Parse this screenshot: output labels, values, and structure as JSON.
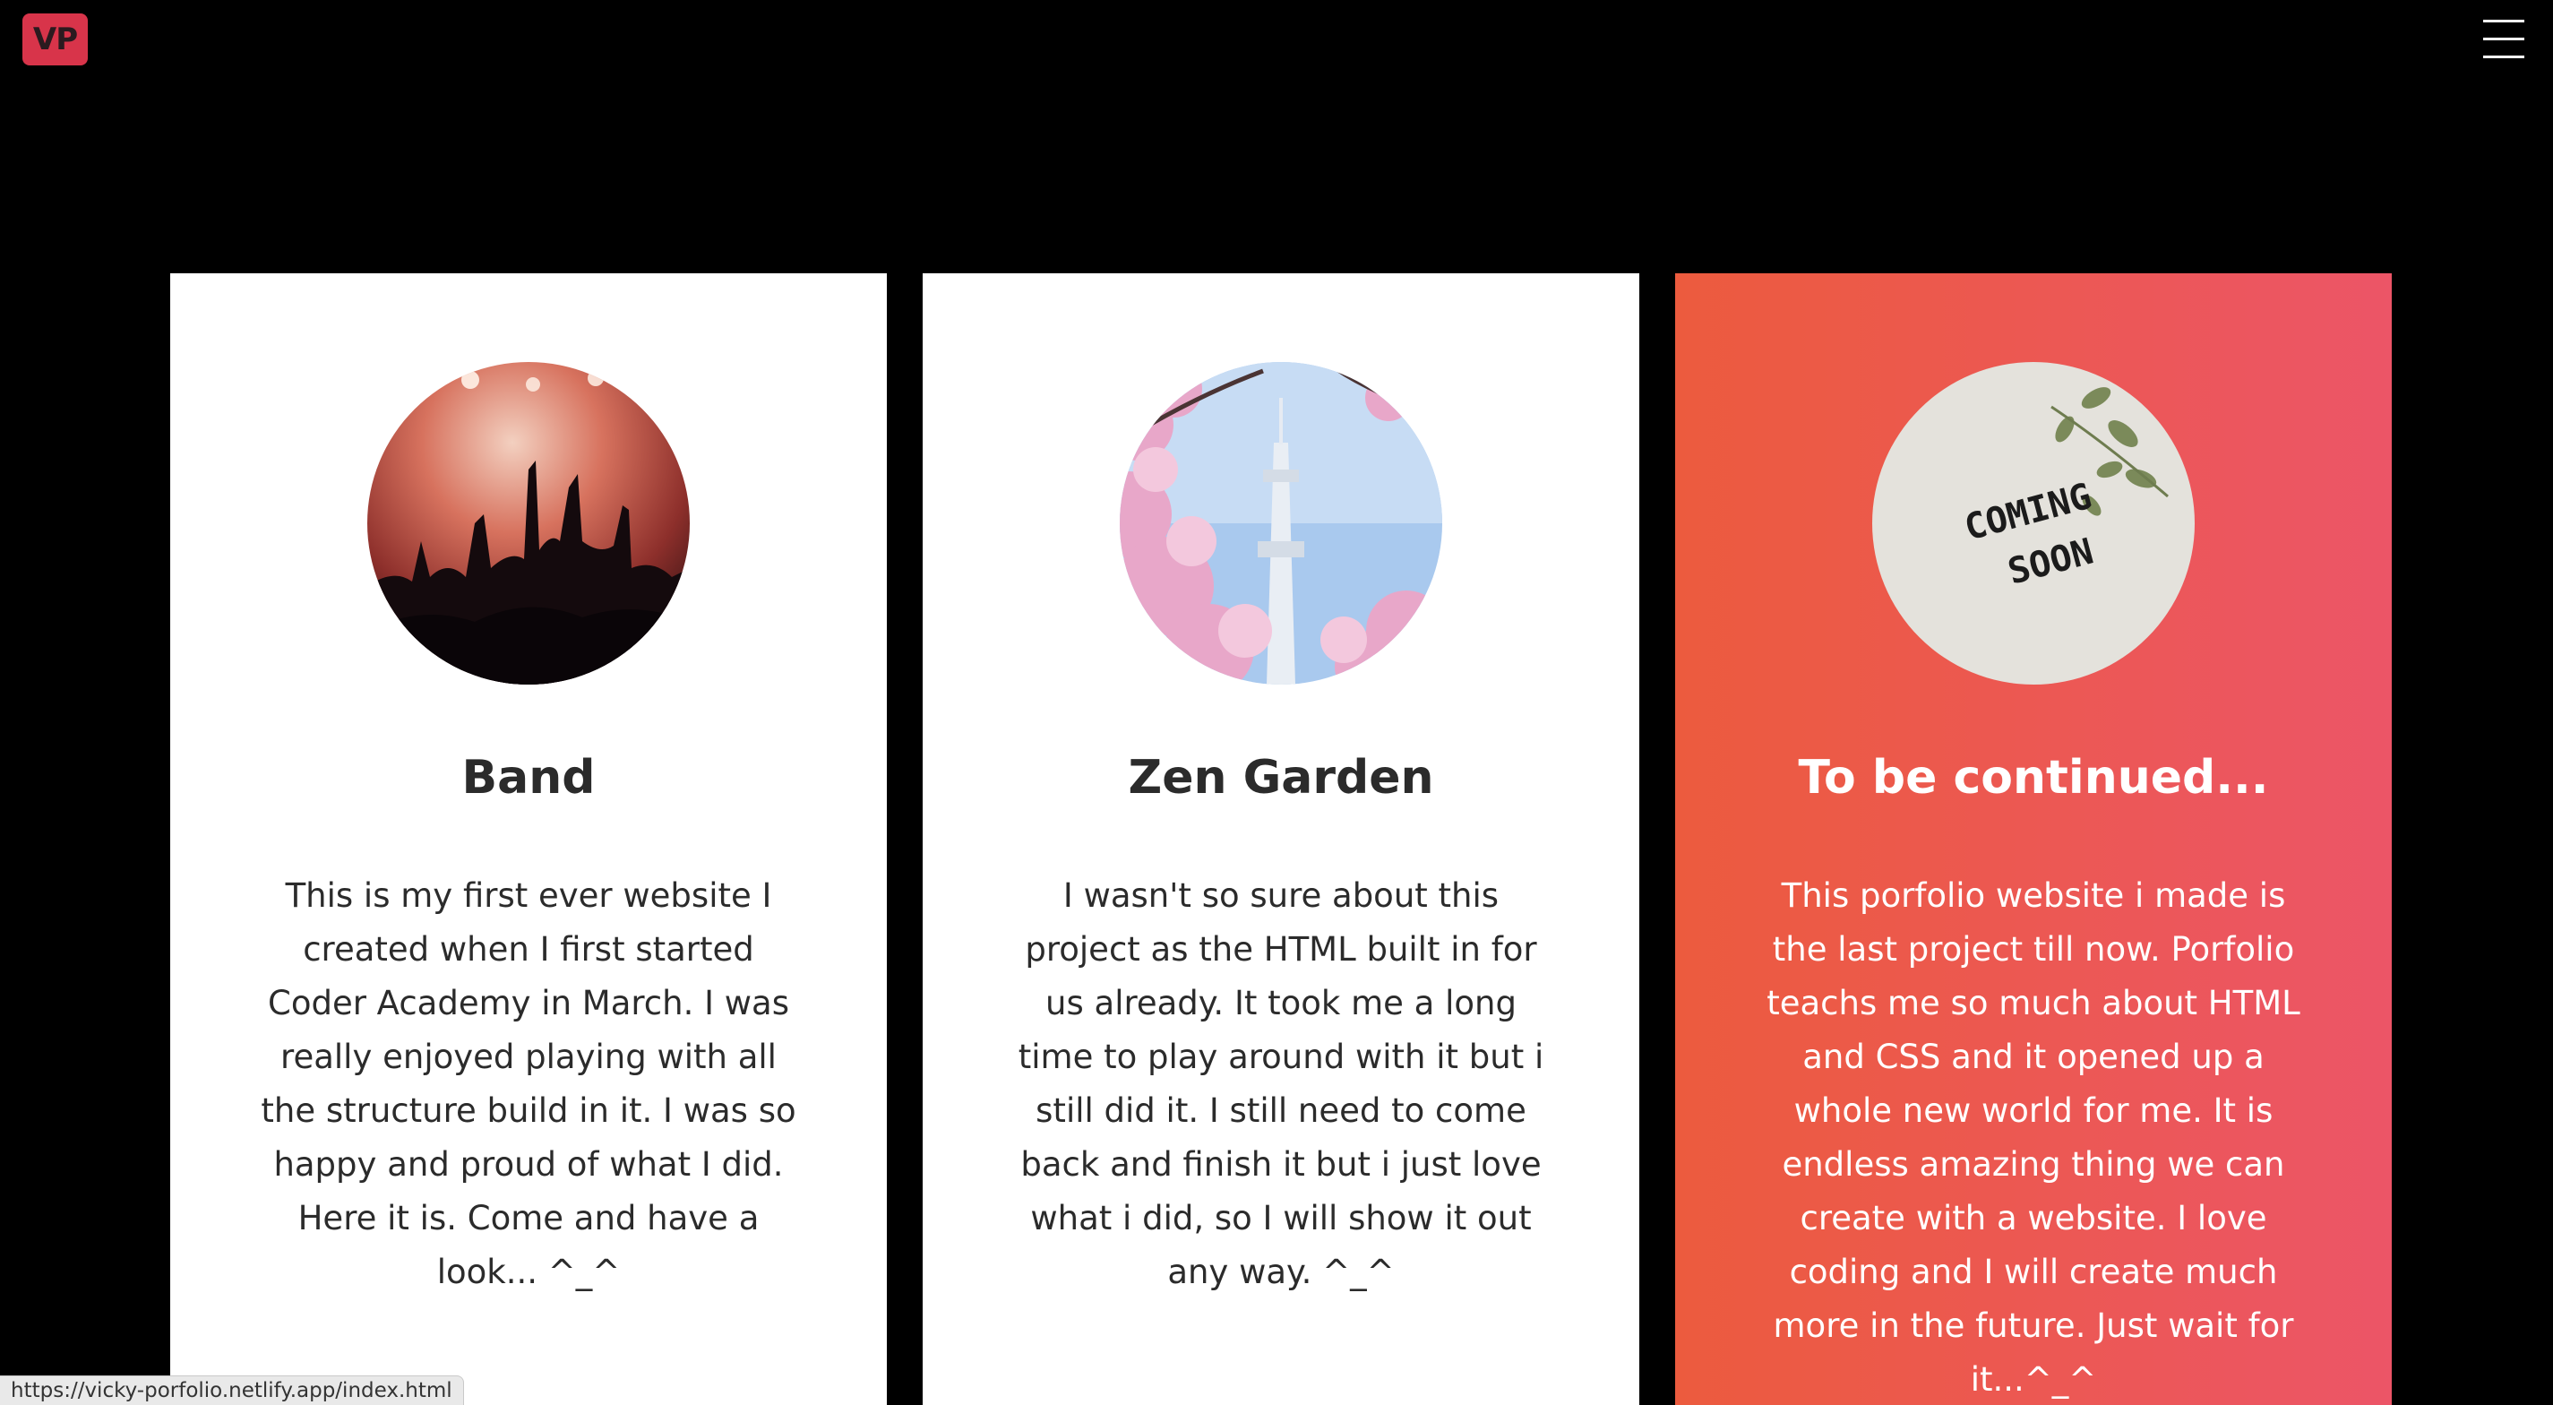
{
  "header": {
    "logo_text": "VP",
    "menu_icon": "hamburger-icon"
  },
  "cards": [
    {
      "title": "Band",
      "text": "This is my first ever website I created when I first started Coder Academy in March. I was really enjoyed playing with all the structure build in it. I was so happy and proud of what I did. Here it is. Come and have a look... ^_^",
      "image": "concert-crowd-photo"
    },
    {
      "title": "Zen Garden",
      "text": "I wasn't so sure about this project as the HTML built in for us already. It took me a long time to play around with it but i still did it. I still need to come back and finish it but i just love what i did, so I will show it out any way. ^_^",
      "image": "cherry-blossom-tower-photo"
    },
    {
      "title": "To be continued...",
      "text": "This porfolio website i made is the last project till now. Porfolio teachs me so much about HTML and CSS and it opened up a whole new world for me. It is endless amazing thing we can create with a website. I love coding and I will create much more in the future. Just wait for it...^_^",
      "image": "coming-soon-photo",
      "image_text_line1": "COMING",
      "image_text_line2": "SOON"
    }
  ],
  "status_bar": {
    "url": "https://vicky-porfolio.netlify.app/index.html"
  },
  "colors": {
    "background": "#000000",
    "card": "#ffffff",
    "accent_gradient_start": "#ec5b3e",
    "accent_gradient_end": "#ec5567",
    "logo": "#d8344a"
  }
}
